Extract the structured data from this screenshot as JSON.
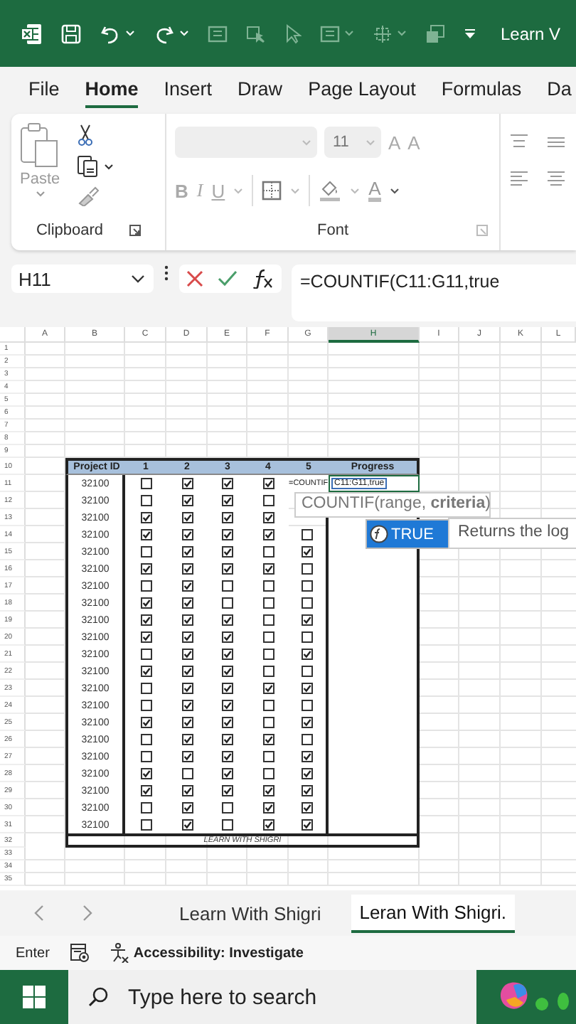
{
  "title_bar": {
    "doc_title": "Learn V"
  },
  "ribbon_tabs": [
    {
      "label": "File",
      "selected": false
    },
    {
      "label": "Home",
      "selected": true
    },
    {
      "label": "Insert",
      "selected": false
    },
    {
      "label": "Draw",
      "selected": false
    },
    {
      "label": "Page Layout",
      "selected": false
    },
    {
      "label": "Formulas",
      "selected": false
    },
    {
      "label": "Da",
      "selected": false
    }
  ],
  "ribbon": {
    "disabled": true,
    "paste_label": "Paste",
    "clipboard_label": "Clipboard",
    "font_size": "11",
    "grow_font": "A",
    "shrink_font": "A",
    "style_buttons": [
      "B",
      "I",
      "U"
    ],
    "font_color": "A",
    "font_label": "Font"
  },
  "formula_bar": {
    "name_box": "H11",
    "formula": "=COUNTIF(C11:G11,true"
  },
  "columns": [
    {
      "label": "A",
      "selected": false
    },
    {
      "label": "B",
      "selected": false
    },
    {
      "label": "C",
      "selected": false
    },
    {
      "label": "D",
      "selected": false
    },
    {
      "label": "E",
      "selected": false
    },
    {
      "label": "F",
      "selected": false
    },
    {
      "label": "G",
      "selected": false
    },
    {
      "label": "H",
      "selected": true
    },
    {
      "label": "I",
      "selected": false
    },
    {
      "label": "J",
      "selected": false
    },
    {
      "label": "K",
      "selected": false
    },
    {
      "label": "L",
      "selected": false
    }
  ],
  "row_numbers": [
    "1",
    "2",
    "3",
    "4",
    "5",
    "6",
    "7",
    "8",
    "9",
    "10",
    "11",
    "12",
    "13",
    "14",
    "15",
    "16",
    "17",
    "18",
    "19",
    "20",
    "21",
    "22",
    "23",
    "24",
    "25",
    "26",
    "27",
    "28",
    "29",
    "30",
    "31",
    "32",
    "33",
    "34",
    "35"
  ],
  "table": {
    "header": [
      "Project ID",
      "1",
      "2",
      "3",
      "4",
      "5",
      "Progress"
    ],
    "rows": [
      {
        "id": "32100",
        "checks": [
          false,
          true,
          true,
          true
        ]
      },
      {
        "id": "32100",
        "checks": [
          false,
          true,
          true,
          false
        ]
      },
      {
        "id": "32100",
        "checks": [
          true,
          true,
          true,
          true
        ]
      },
      {
        "id": "32100",
        "checks": [
          true,
          true,
          true,
          true,
          false
        ]
      },
      {
        "id": "32100",
        "checks": [
          false,
          true,
          true,
          false,
          true
        ]
      },
      {
        "id": "32100",
        "checks": [
          true,
          true,
          true,
          true,
          false
        ]
      },
      {
        "id": "32100",
        "checks": [
          false,
          true,
          false,
          false,
          false
        ]
      },
      {
        "id": "32100",
        "checks": [
          true,
          true,
          false,
          false,
          false
        ]
      },
      {
        "id": "32100",
        "checks": [
          true,
          true,
          true,
          false,
          true
        ]
      },
      {
        "id": "32100",
        "checks": [
          true,
          true,
          true,
          false,
          false
        ]
      },
      {
        "id": "32100",
        "checks": [
          false,
          true,
          true,
          false,
          true
        ]
      },
      {
        "id": "32100",
        "checks": [
          true,
          true,
          true,
          false,
          false
        ]
      },
      {
        "id": "32100",
        "checks": [
          false,
          true,
          true,
          true,
          true
        ]
      },
      {
        "id": "32100",
        "checks": [
          false,
          true,
          true,
          false,
          false
        ]
      },
      {
        "id": "32100",
        "checks": [
          true,
          true,
          true,
          false,
          true
        ]
      },
      {
        "id": "32100",
        "checks": [
          false,
          true,
          true,
          true,
          false
        ]
      },
      {
        "id": "32100",
        "checks": [
          false,
          true,
          true,
          false,
          true
        ]
      },
      {
        "id": "32100",
        "checks": [
          true,
          false,
          true,
          false,
          true
        ]
      },
      {
        "id": "32100",
        "checks": [
          true,
          true,
          true,
          true,
          true
        ]
      },
      {
        "id": "32100",
        "checks": [
          false,
          true,
          false,
          true,
          true
        ]
      },
      {
        "id": "32100",
        "checks": [
          false,
          true,
          false,
          true,
          true
        ]
      }
    ],
    "footer": "LEARN WITH SHIGRI"
  },
  "cell_editor": {
    "function_part": "=COUNTIF",
    "reference_part": "C11:G11,true"
  },
  "function_tooltip": "COUNTIF(range, **criteria**)",
  "autocomplete": {
    "items": [
      {
        "label": "TRUE",
        "selected": true
      }
    ],
    "description": "Returns the log"
  },
  "sheet_tabs": [
    {
      "label": "Learn With Shigri",
      "selected": false
    },
    {
      "label": "Leran With Shigri.",
      "selected": true
    }
  ],
  "status_bar": {
    "mode": "Enter",
    "accessibility": "Accessibility: Investigate"
  },
  "taskbar": {
    "search_placeholder": "Type here to search"
  }
}
